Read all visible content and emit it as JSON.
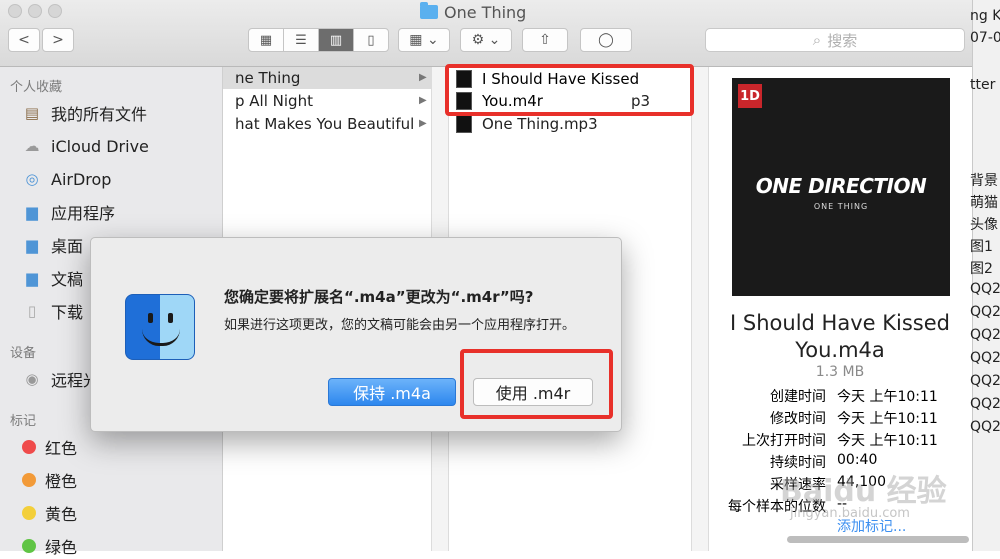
{
  "window": {
    "title": "One Thing"
  },
  "toolbar": {
    "back": "<",
    "forward": ">",
    "view_icon": "▦",
    "view_list": "☰",
    "view_columns": "▥",
    "view_cover": "▯",
    "arrange": "▦ ⌄",
    "action": "⚙ ⌄",
    "share": "⇧",
    "tag": "◯",
    "search_placeholder": "搜索"
  },
  "sidebar": {
    "favorites_heading": "个人收藏",
    "favorites": [
      {
        "label": "我的所有文件",
        "icon": "all-files-icon"
      },
      {
        "label": "iCloud Drive",
        "icon": "cloud-icon"
      },
      {
        "label": "AirDrop",
        "icon": "airdrop-icon"
      },
      {
        "label": "应用程序",
        "icon": "applications-icon"
      },
      {
        "label": "桌面",
        "icon": "desktop-icon"
      },
      {
        "label": "文稿",
        "icon": "documents-icon"
      },
      {
        "label": "下载",
        "icon": "downloads-icon"
      }
    ],
    "devices_heading": "设备",
    "devices": [
      {
        "label": "远程光",
        "icon": "disc-icon"
      }
    ],
    "tags_heading": "标记",
    "tags": [
      {
        "label": "红色",
        "color": "#ef4b4b"
      },
      {
        "label": "橙色",
        "color": "#f29a38"
      },
      {
        "label": "黄色",
        "color": "#f3cf3a"
      },
      {
        "label": "绿色",
        "color": "#60c445"
      }
    ]
  },
  "column1": {
    "items": [
      "ne Thing",
      "p All Night",
      "hat Makes You Beautiful"
    ]
  },
  "column2": {
    "items": [
      {
        "label": "I Should Have Kissed",
        "sub": "You.m4r",
        "suffix": "p3"
      },
      {
        "label": "One Thing.mp3"
      }
    ]
  },
  "preview": {
    "album_logo": "1D",
    "album_band": "ONE DIRECTION",
    "album_sub": "ONE THING",
    "file_name": "I Should Have Kissed You.m4a",
    "size": "1.3 MB",
    "meta": [
      {
        "k": "创建时间",
        "v": "今天 上午10:11"
      },
      {
        "k": "修改时间",
        "v": "今天 上午10:11"
      },
      {
        "k": "上次打开时间",
        "v": "今天 上午10:11"
      },
      {
        "k": "持续时间",
        "v": "00:40"
      },
      {
        "k": "采样速率",
        "v": "44,100"
      },
      {
        "k": "每个样本的位数",
        "v": "--"
      }
    ],
    "add_tags": "添加标记..."
  },
  "dialog": {
    "title": "您确定要将扩展名“.m4a”更改为“.m4r”吗?",
    "body": "如果进行这项更改，您的文稿可能会由另一个应用程序打开。",
    "keep_button": "保持 .m4a",
    "use_button": "使用 .m4r"
  },
  "right_strip": {
    "items": [
      "ng K",
      "07-0",
      "tter",
      "背景",
      "萌猫",
      "头像",
      "图1",
      "图2",
      "QQ2",
      "QQ2",
      "QQ2",
      "QQ2",
      "QQ2",
      "QQ2",
      "QQ2"
    ]
  },
  "watermark": {
    "line1": "Baidu 经验",
    "line2": "jingyan.baidu.com"
  },
  "colors": {
    "accent": "#3c8ff0",
    "highlight_box": "#e8302a"
  }
}
